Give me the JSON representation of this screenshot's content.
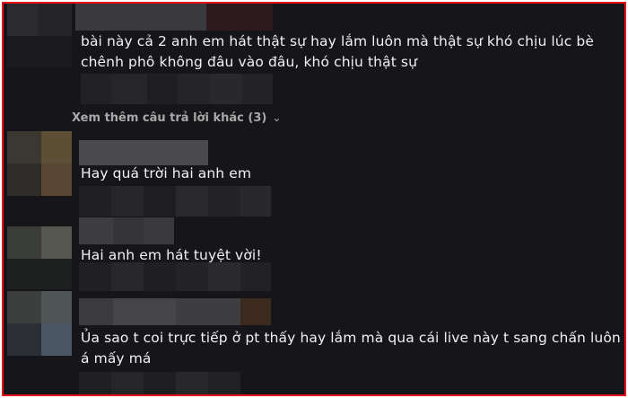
{
  "comments": [
    {
      "lines": [
        "bài này cả 2 anh em hát thật sự hay lắm luôn mà thật sự khó chịu lúc bè",
        "chênh phô không đâu vào đâu, khó chịu thật sự"
      ]
    },
    {
      "lines": [
        "Hay quá trời hai anh em"
      ]
    },
    {
      "lines": [
        "Hai anh em hát tuyệt vời!"
      ]
    },
    {
      "lines": [
        "Ủa sao t coi trực tiếp ở pt thấy hay lắm mà qua cái live này t sang chấn luôn",
        "á mấy má"
      ]
    }
  ],
  "more_replies": {
    "label": "Xem thêm câu trả lời khác (3)",
    "icon": "chevron-down-icon"
  }
}
